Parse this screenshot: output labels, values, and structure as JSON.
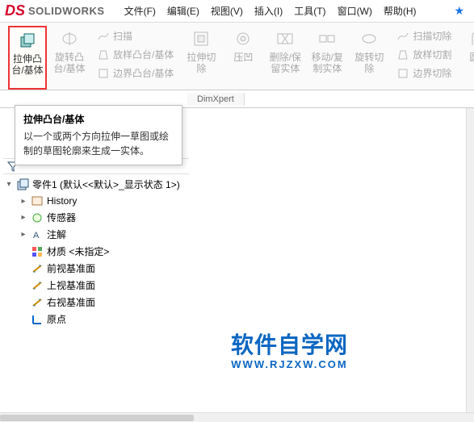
{
  "app": {
    "logo_text": "SOLIDWORKS"
  },
  "menu": {
    "items": [
      "文件(F)",
      "编辑(E)",
      "视图(V)",
      "插入(I)",
      "工具(T)",
      "窗口(W)",
      "帮助(H)"
    ]
  },
  "ribbon": {
    "extrude": "拉伸凸台/基体",
    "revolve": "旋转凸台/基体",
    "sweep": "扫描",
    "loft": "放样凸台/基体",
    "boundary": "边界凸台/基体",
    "cut_extrude": "拉伸切除",
    "hole": "压凹",
    "delete_keep": "删除/保留实体",
    "move_copy": "移动/复制实体",
    "cut_revolve": "旋转切除",
    "cut_sweep": "扫描切除",
    "cut_loft": "放样切割",
    "cut_boundary": "边界切除",
    "fillet": "圆角"
  },
  "tabs": {
    "dimxpert": "DimXpert"
  },
  "tooltip": {
    "title": "拉伸凸台/基体",
    "desc": "以一个或两个方向拉伸一草图或绘制的草图轮廓来生成一实体。"
  },
  "tree": {
    "root": "零件1  (默认<<默认>_显示状态 1>)",
    "history": "History",
    "sensors": "传感器",
    "annotations": "注解",
    "material": "材质 <未指定>",
    "front": "前视基准面",
    "top": "上视基准面",
    "right": "右视基准面",
    "origin": "原点"
  },
  "watermark": {
    "main": "软件自学网",
    "sub": "WWW.RJZXW.COM"
  }
}
